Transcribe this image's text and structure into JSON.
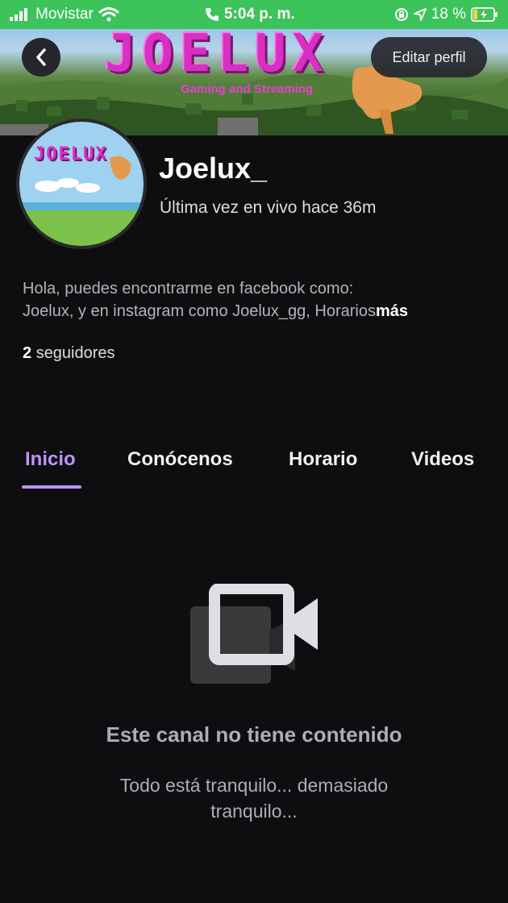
{
  "status_bar": {
    "carrier": "Movistar",
    "time": "5:04 p. m.",
    "battery": "18 %",
    "color": "#3cc35a"
  },
  "banner": {
    "logo_text": "JOELUX",
    "tagline": "Gaming and Streaming",
    "edit_button": "Editar perfil"
  },
  "avatar": {
    "logo_text": "JOELUX"
  },
  "profile": {
    "username": "Joelux_",
    "last_live": "Última vez en vivo hace 36m",
    "bio_line1": "Hola, puedes encontrarme en facebook como:",
    "bio_line2": "Joelux, y en instagram como Joelux_gg, Horarios",
    "more": "más",
    "followers_count": "2",
    "followers_label": "seguidores"
  },
  "tabs": [
    {
      "label": "Inicio",
      "active": true
    },
    {
      "label": "Conócenos",
      "active": false
    },
    {
      "label": "Horario",
      "active": false
    },
    {
      "label": "Videos",
      "active": false
    }
  ],
  "empty_state": {
    "title": "Este canal no tiene contenido",
    "subtitle": "Todo está tranquilo... demasiado tranquilo..."
  },
  "colors": {
    "accent": "#bf94ff",
    "background": "#0e0e10"
  }
}
